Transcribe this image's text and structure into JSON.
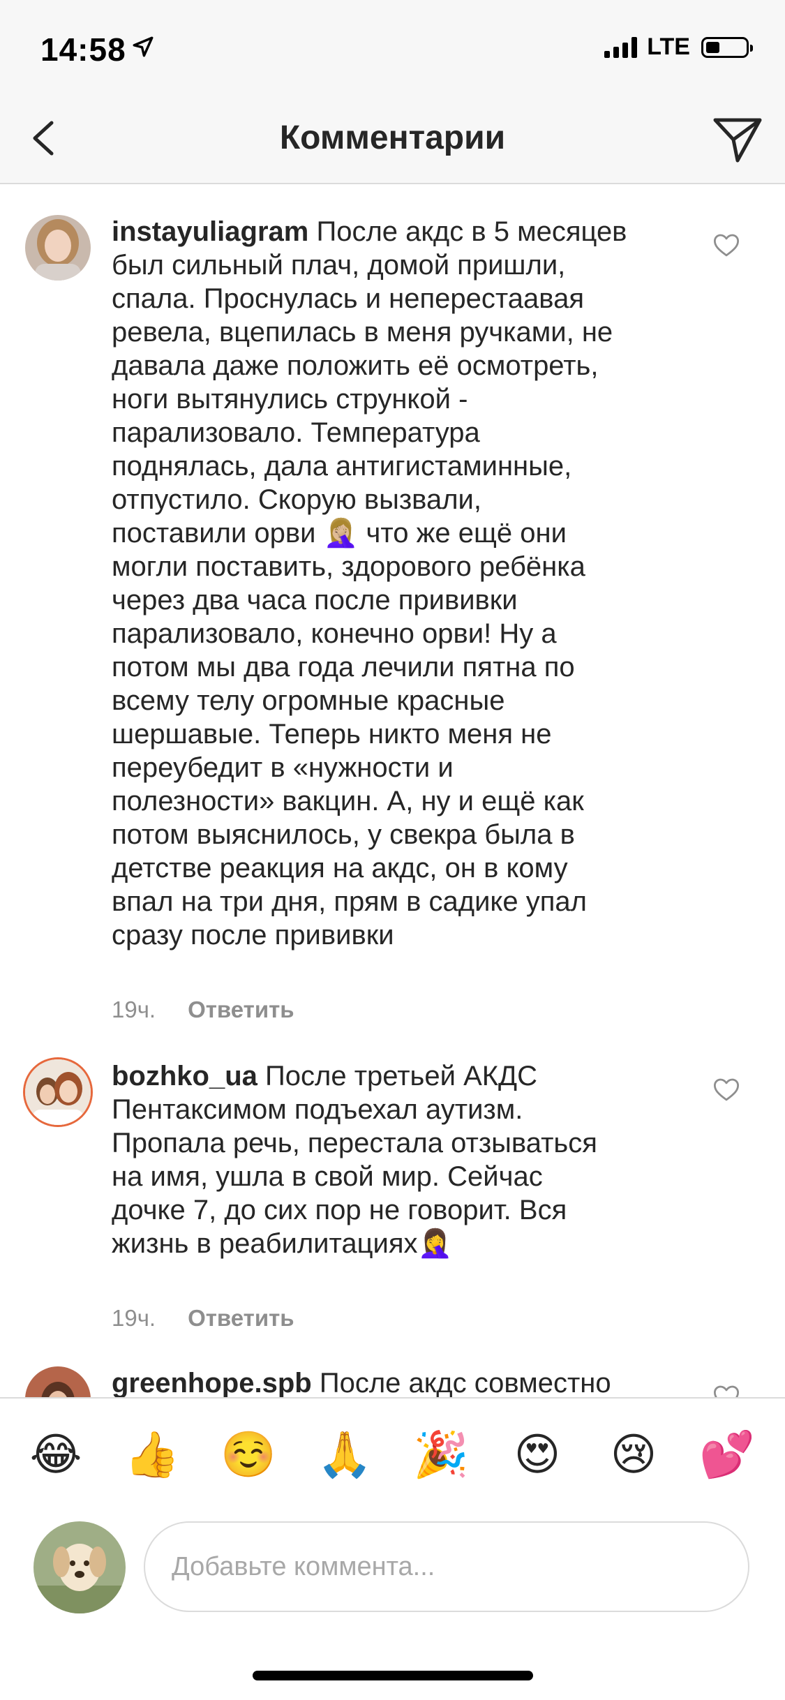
{
  "status_bar": {
    "time": "14:58",
    "network": "LTE",
    "battery_level": 0.35
  },
  "nav": {
    "title": "Комментарии"
  },
  "comments": [
    {
      "username": "instayuliagram",
      "lines": [
        "После акдс в 5 месяцев",
        "был сильный плач, домой пришли,",
        "спала. Проснулась и неперестаавая",
        "ревела, вцепилась в меня ручками, не",
        "давала даже положить её осмотреть,",
        "ноги вытянулись стрункой -",
        "парализовало. Температура",
        "поднялась, дала антигистаминные,",
        "отпустило. Скорую вызвали,",
        "поставили орви 🤦🏼‍♀️ что же ещё они",
        "могли поставить, здорового ребёнка",
        "через два часа после прививки",
        "парализовало, конечно орви! Ну а",
        "потом мы два года лечили пятна по",
        "всему телу огромные красные",
        "шершавые. Теперь никто меня не",
        "переубедит в «нужности и",
        "полезности» вакцин. А, ну и ещё как",
        "потом выяснилось, у свекра была в",
        "детстве реакция на акдс, он в кому",
        "впал на три дня, прям в садике упал",
        "сразу после прививки"
      ],
      "time": "19ч.",
      "reply_label": "Ответить"
    },
    {
      "username": "bozhko_ua",
      "lines": [
        "После третьей АКДС",
        "Пентаксимом подъехал аутизм.",
        "Пропала речь, перестала отзываться",
        "на имя, ушла в свой мир. Сейчас",
        "дочке 7, до сих пор не говорит. Вся",
        "жизнь в реабилитациях🤦‍♀️"
      ],
      "time": "19ч.",
      "reply_label": "Ответить"
    },
    {
      "username": "greenhope.spb",
      "lines": [
        "После акдс совместно"
      ]
    }
  ],
  "emoji_bar": [
    "😂",
    "👍",
    "☺️",
    "🙏",
    "🎉",
    "😍",
    "😢",
    "💕"
  ],
  "input": {
    "placeholder": "Добавьте коммента..."
  }
}
